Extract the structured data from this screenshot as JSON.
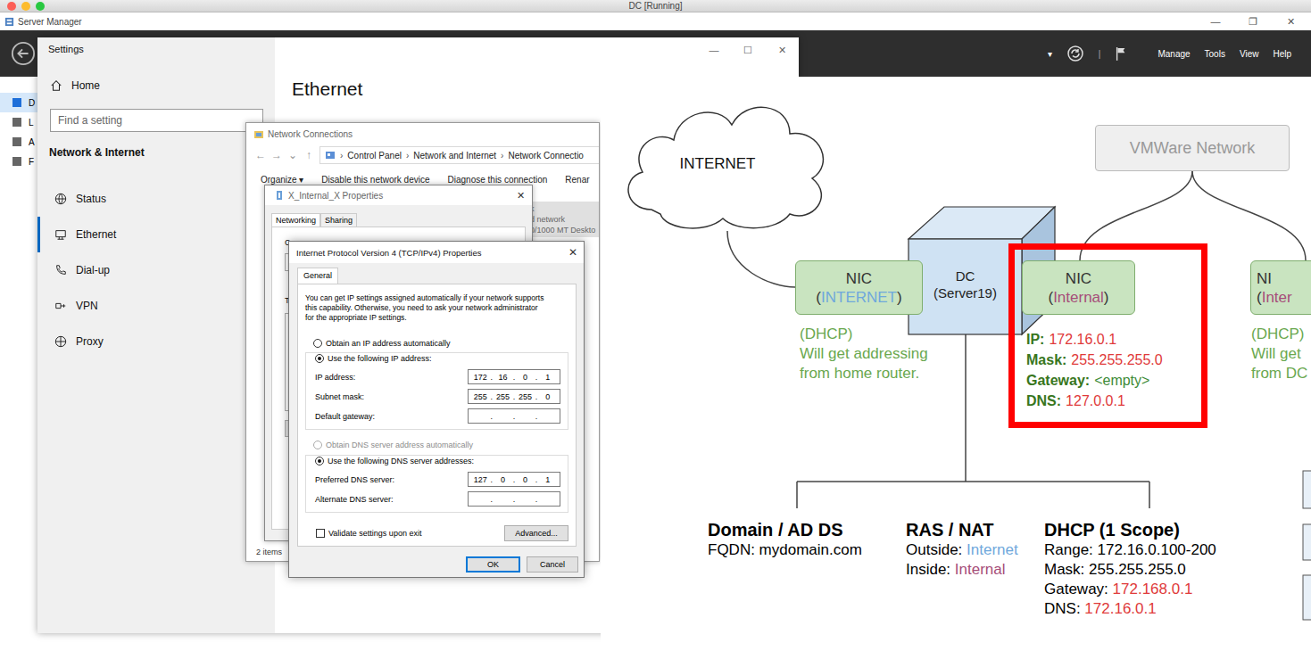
{
  "host": {
    "title": "DC [Running]"
  },
  "server_manager": {
    "title": "Server Manager",
    "caption_buttons": [
      "—",
      "❐",
      "✕"
    ],
    "dropdown": "▾",
    "separator": "|",
    "menu": [
      "Manage",
      "Tools",
      "View",
      "Help"
    ],
    "sidebar": [
      {
        "label": "D",
        "selected": true
      },
      {
        "label": "L",
        "selected": false
      },
      {
        "label": "A",
        "selected": false
      },
      {
        "label": "F",
        "selected": false
      }
    ]
  },
  "settings": {
    "title": "Settings",
    "caption_buttons": [
      "—",
      "☐",
      "✕"
    ],
    "home": "Home",
    "search_placeholder": "Find a setting",
    "section": "Network & Internet",
    "items": [
      {
        "label": "Status",
        "selected": false
      },
      {
        "label": "Ethernet",
        "selected": true
      },
      {
        "label": "Dial-up",
        "selected": false
      },
      {
        "label": "VPN",
        "selected": false
      },
      {
        "label": "Proxy",
        "selected": false
      }
    ],
    "page_title": "Ethernet"
  },
  "network_connections": {
    "title": "Network Connections",
    "nav": [
      "←",
      "→",
      "⌄",
      "↑"
    ],
    "crumb_separator": "›",
    "crumbs": [
      "Control Panel",
      "Network and Internet",
      "Network Connectio"
    ],
    "toolbar": [
      "Organize ▾",
      "Disable this network device",
      "Diagnose this connection",
      "Renar"
    ],
    "adapter": {
      "lines": [
        "k",
        "d network",
        "0/1000 MT Deskto"
      ],
      "selected": true
    },
    "status": "2 items"
  },
  "properties": {
    "title": "X_Internal_X Properties",
    "close": "✕",
    "tabs": [
      {
        "label": "Networking",
        "selected": true
      },
      {
        "label": "Sharing",
        "selected": false
      }
    ],
    "fragments": [
      "Co",
      "Th",
      "D"
    ]
  },
  "ipv4": {
    "title": "Internet Protocol Version 4 (TCP/IPv4) Properties",
    "close": "✕",
    "tab": "General",
    "description": [
      "You can get IP settings assigned automatically if your network supports",
      "this capability. Otherwise, you need to ask your network administrator",
      "for the appropriate IP settings."
    ],
    "separator": ".",
    "ip_auto": {
      "label": "Obtain an IP address automatically",
      "selected": false,
      "disabled": false
    },
    "ip_manual": {
      "label": "Use the following IP address:",
      "selected": true,
      "disabled": false
    },
    "ip_fields": [
      {
        "label": "IP address:",
        "octets": [
          "172",
          "16",
          "0",
          "1"
        ]
      },
      {
        "label": "Subnet mask:",
        "octets": [
          "255",
          "255",
          "255",
          "0"
        ]
      },
      {
        "label": "Default gateway:",
        "octets": [
          "",
          "",
          "",
          ""
        ]
      }
    ],
    "dns_auto": {
      "label": "Obtain DNS server address automatically",
      "selected": false,
      "disabled": true
    },
    "dns_manual": {
      "label": "Use the following DNS server addresses:",
      "selected": true,
      "disabled": false
    },
    "dns_fields": [
      {
        "label": "Preferred DNS server:",
        "octets": [
          "127",
          "0",
          "0",
          "1"
        ]
      },
      {
        "label": "Alternate DNS server:",
        "octets": [
          "",
          "",
          "",
          ""
        ]
      }
    ],
    "validate": {
      "label": "Validate settings upon exit",
      "checked": false
    },
    "advanced": "Advanced...",
    "ok": "OK",
    "cancel": "Cancel"
  },
  "diagram": {
    "cloud": "INTERNET",
    "network": "VMWare Network",
    "server": {
      "name": "DC",
      "subtitle": "(Server19)"
    },
    "nics": [
      {
        "title": "NIC",
        "open": "(",
        "label": "INTERNET",
        "close": ")",
        "color": "#6fa8dc",
        "highlighted": false,
        "note": [
          "(DHCP)",
          "Will get addressing",
          "from home router."
        ],
        "details": []
      },
      {
        "title": "NIC",
        "open": "(",
        "label": "Internal",
        "close": ")",
        "color": "#a64d79",
        "highlighted": true,
        "note": [],
        "details": [
          {
            "key": "IP:",
            "value": "172.16.0.1",
            "color": "#e03a3a"
          },
          {
            "key": "Mask:",
            "value": "255.255.255.0",
            "color": "#e03a3a"
          },
          {
            "key": "Gateway:",
            "value": "<empty>",
            "color": "#3d8b37"
          },
          {
            "key": "DNS:",
            "value": "127.0.0.1",
            "color": "#e03a3a"
          }
        ]
      },
      {
        "title": "NI",
        "open": "(",
        "label": "Inter",
        "close": "",
        "color": "#a64d79",
        "highlighted": false,
        "note": [
          "(DHCP)",
          "Will get",
          "from DC"
        ],
        "details": []
      }
    ],
    "services": [
      {
        "title": "Domain / AD DS",
        "lines": [
          [
            {
              "text": "FQDN: mydomain.com",
              "color": "#000000"
            }
          ]
        ]
      },
      {
        "title": "RAS / NAT",
        "lines": [
          [
            {
              "text": "Outside: ",
              "color": "#000000"
            },
            {
              "text": "Internet",
              "color": "#6fa8dc"
            }
          ],
          [
            {
              "text": "Inside: ",
              "color": "#000000"
            },
            {
              "text": "Internal",
              "color": "#a64d79"
            }
          ]
        ]
      },
      {
        "title": "DHCP (1 Scope)",
        "lines": [
          [
            {
              "text": "Range: 172.16.0.100-200",
              "color": "#000000"
            }
          ],
          [
            {
              "text": "Mask: 255.255.255.0",
              "color": "#000000"
            }
          ],
          [
            {
              "text": "Gateway: ",
              "color": "#000000"
            },
            {
              "text": "172.168.0.1",
              "color": "#e03a3a"
            }
          ],
          [
            {
              "text": "DNS: ",
              "color": "#000000"
            },
            {
              "text": "172.16.0.1",
              "color": "#e03a3a"
            }
          ]
        ]
      }
    ]
  }
}
